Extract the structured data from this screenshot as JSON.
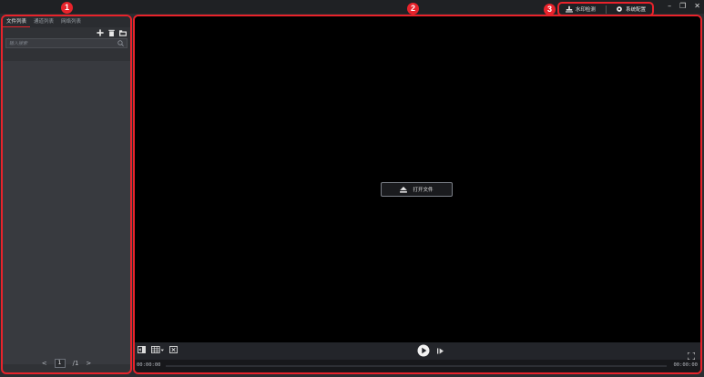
{
  "badges": {
    "left": "1",
    "right": "2",
    "tools": "3"
  },
  "top_tools": {
    "watermark_label": "水印检测",
    "settings_label": "系统配置"
  },
  "window_controls": {
    "minimize": "–",
    "restore": "❐",
    "close": "✕"
  },
  "left_panel": {
    "tabs": [
      {
        "label": "文件列表",
        "active": true
      },
      {
        "label": "通道列表",
        "active": false
      },
      {
        "label": "网络列表",
        "active": false
      }
    ],
    "search": {
      "placeholder": "输入搜索"
    },
    "pager": {
      "prev": "<",
      "current_page": "1",
      "total": "/1",
      "next": ">"
    }
  },
  "player": {
    "open_file_label": "打开文件",
    "time_start": "00:00:00",
    "time_end": "00:00:00"
  },
  "colors": {
    "accent_red": "#e8232b",
    "bg_dark": "#2b2d31",
    "video_bg": "#000000"
  }
}
